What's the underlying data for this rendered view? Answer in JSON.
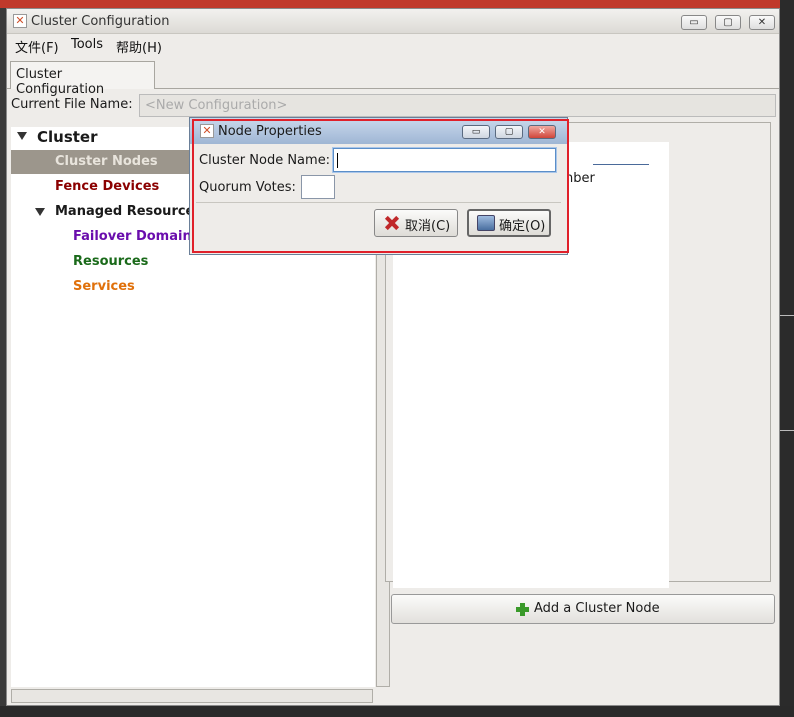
{
  "window": {
    "title": "Cluster Configuration",
    "min_glyph": "▭",
    "max_glyph": "▢",
    "close_glyph": "✕"
  },
  "menu": {
    "file": "文件(F)",
    "tools": "Tools",
    "help": "帮助(H)"
  },
  "tab": {
    "label": "Cluster Configuration"
  },
  "file_name": {
    "label": "Current File Name:",
    "value": "<New Configuration>"
  },
  "tree": {
    "root": "Cluster",
    "cluster_nodes": "Cluster Nodes",
    "fence_devices": "Fence Devices",
    "managed_resources": "Managed Resources",
    "failover_domains": "Failover Domains",
    "resources": "Resources",
    "services": "Services",
    "colors": {
      "cluster_nodes": "#e8e4dc",
      "fence_devices": "#8b0000",
      "failover_domains": "#6a0dad",
      "resources": "#1a6a1a",
      "services": "#e0700a"
    }
  },
  "right_panel": {
    "partial_text": "nber",
    "add_node_button": "Add a Cluster Node"
  },
  "dialog": {
    "title": "Node Properties",
    "node_name_label": "Cluster Node Name:",
    "node_name_value": "",
    "quorum_label": "Quorum Votes:",
    "quorum_value": "",
    "cancel_button": "取消(C)",
    "ok_button": "确定(O)"
  }
}
